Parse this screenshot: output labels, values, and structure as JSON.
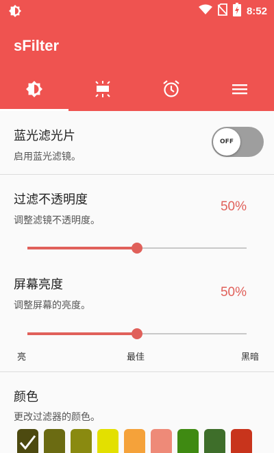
{
  "status_bar": {
    "time": "8:52"
  },
  "app": {
    "title": "sFilter"
  },
  "tabs": [
    {
      "icon": "brightness-icon",
      "active": true
    },
    {
      "icon": "screen-dim-icon",
      "active": false
    },
    {
      "icon": "alarm-clock-icon",
      "active": false
    },
    {
      "icon": "menu-icon",
      "active": false
    }
  ],
  "filter_toggle": {
    "title": "蓝光滤光片",
    "subtitle": "启用蓝光滤镜。",
    "state_label": "OFF"
  },
  "opacity": {
    "title": "过滤不透明度",
    "subtitle": "调整滤镜不透明度。",
    "value_label": "50%",
    "value": 0.5
  },
  "brightness": {
    "title": "屏幕亮度",
    "subtitle": "调整屏幕的亮度。",
    "value_label": "50%",
    "value": 0.5,
    "scale": {
      "left": "亮",
      "middle": "最佳",
      "right": "黑暗"
    }
  },
  "color": {
    "title": "颜色",
    "subtitle": "更改过滤器的颜色。",
    "swatches": [
      "#4d4a10",
      "#6b6b12",
      "#8a8a10",
      "#e3e000",
      "#f5a23a",
      "#ee8a78",
      "#3f8a12",
      "#3e6e2a",
      "#c8341c"
    ],
    "selected_index": 0
  },
  "colors": {
    "accent": "#ef5350",
    "slider": "#e0605a"
  }
}
